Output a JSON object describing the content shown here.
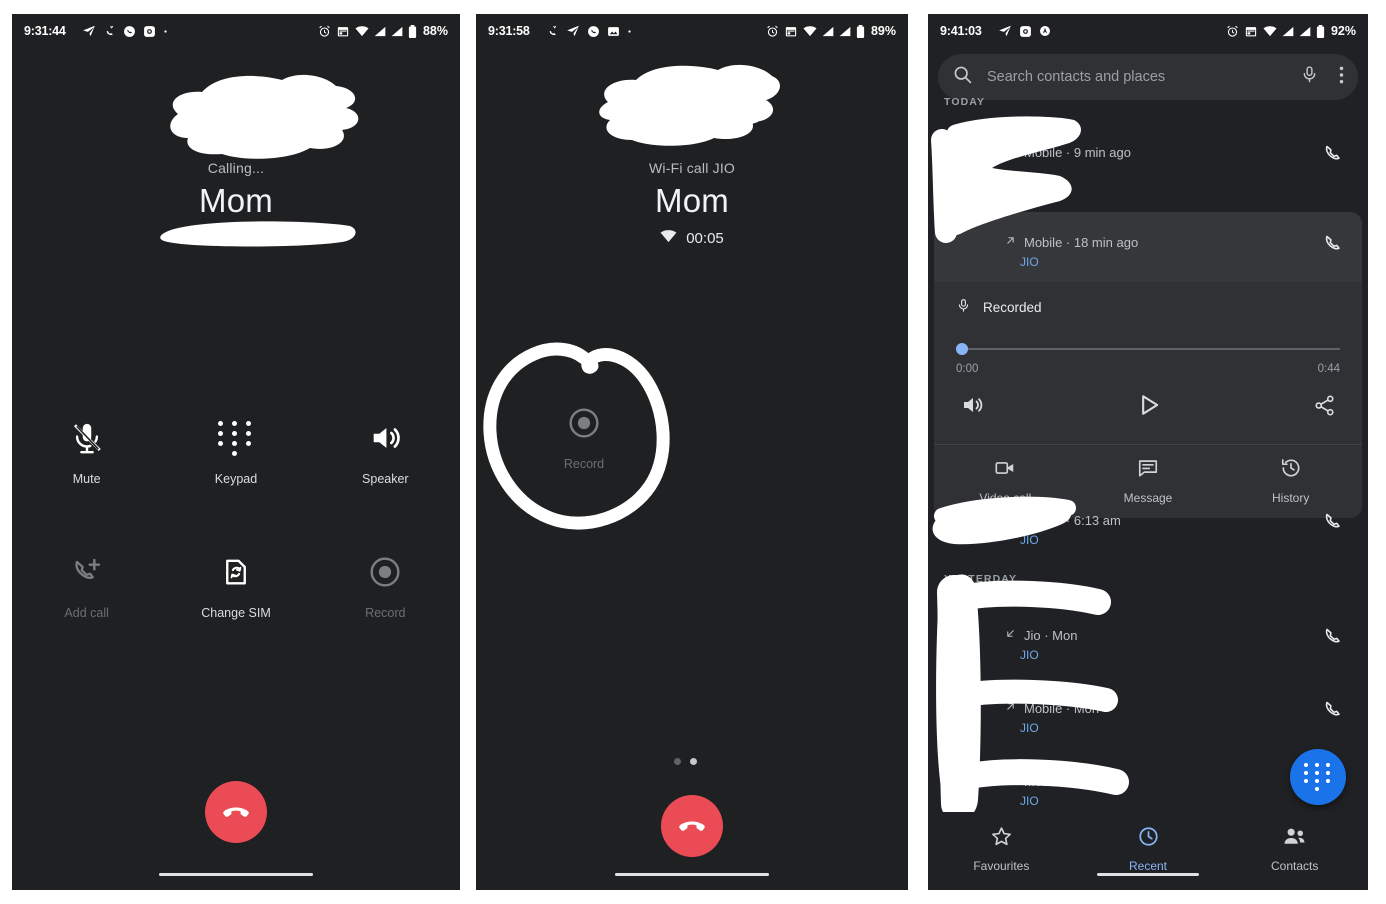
{
  "panels": [
    {
      "id": "incall-dialing",
      "statusbar": {
        "time": "9:31:44",
        "battery": "88%",
        "left_icons": [
          "navigation-icon",
          "call-missed-icon",
          "phone-icon",
          "photos-icon",
          "dot-icon"
        ],
        "right_icons": [
          "alarm-icon",
          "calendar-icon",
          "wifi-icon",
          "signal-icon",
          "signal-icon",
          "battery-icon"
        ]
      },
      "call": {
        "status": "Calling...",
        "name": "Mom"
      },
      "controls": [
        {
          "name": "mute",
          "label": "Mute",
          "icon": "mic-off-icon",
          "dim": false
        },
        {
          "name": "keypad",
          "label": "Keypad",
          "icon": "dialpad-icon",
          "dim": false
        },
        {
          "name": "speaker",
          "label": "Speaker",
          "icon": "volume-up-icon",
          "dim": false
        },
        {
          "name": "add-call",
          "label": "Add call",
          "icon": "add-call-icon",
          "dim": true
        },
        {
          "name": "change-sim",
          "label": "Change SIM",
          "icon": "sim-swap-icon",
          "dim": false
        },
        {
          "name": "record",
          "label": "Record",
          "icon": "record-icon",
          "dim": true
        }
      ],
      "end_call_icon": "call-end-icon"
    },
    {
      "id": "incall-connected",
      "statusbar": {
        "time": "9:31:58",
        "battery": "89%"
      },
      "call": {
        "status": "Wi-Fi call JIO",
        "name": "Mom",
        "duration": "00:05"
      },
      "controls": [
        {
          "name": "record",
          "label": "Record",
          "icon": "record-icon",
          "dim": true
        }
      ],
      "page_dots": {
        "count": 2,
        "active_index": 1
      },
      "end_call_icon": "call-end-icon"
    },
    {
      "id": "recents",
      "statusbar": {
        "time": "9:41:03",
        "battery": "92%"
      },
      "search": {
        "placeholder": "Search contacts and places",
        "search_icon": "search-icon",
        "voice_icon": "mic-icon",
        "overflow_icon": "more-vert-icon"
      },
      "sections": [
        {
          "header": "TODAY",
          "rows": [
            {
              "direction_icon": "call-outgoing-icon",
              "meta": "Mobile · 9 min ago",
              "sim": "",
              "action_icon": "phone-icon",
              "selected": false
            },
            {
              "direction_icon": "call-outgoing-icon",
              "meta": "Mobile · 18 min ago",
              "sim": "JIO",
              "action_icon": "phone-icon",
              "selected": true
            },
            {
              "direction_icon": "call-outgoing-icon",
              "meta": "Mobile · 6:13 am",
              "sim": "JIO",
              "action_icon": "phone-icon",
              "selected": false
            }
          ]
        },
        {
          "header": "YESTERDAY",
          "rows": [
            {
              "direction_icon": "call-incoming-icon",
              "meta": "Jio · Mon",
              "sim": "JIO",
              "action_icon": "phone-icon",
              "selected": false
            },
            {
              "direction_icon": "call-outgoing-icon",
              "meta": "Mobile · Mon",
              "sim": "JIO",
              "action_icon": "phone-icon",
              "selected": false
            },
            {
              "direction_icon": "call-outgoing-icon",
              "meta": "Mobile · Mon",
              "sim": "JIO",
              "action_icon": "phone-icon",
              "selected": false
            }
          ]
        }
      ],
      "recording": {
        "title": "Recorded",
        "mic_icon": "mic-icon",
        "elapsed": "0:00",
        "total": "0:44",
        "progress_percent": 0,
        "volume_icon": "volume-up-icon",
        "play_icon": "play-icon",
        "share_icon": "share-icon"
      },
      "quick_actions": [
        {
          "name": "video-call",
          "label": "Video call",
          "icon": "videocam-icon"
        },
        {
          "name": "message",
          "label": "Message",
          "icon": "message-icon"
        },
        {
          "name": "history",
          "label": "History",
          "icon": "history-icon"
        }
      ],
      "fab": {
        "name": "dialpad-fab",
        "icon": "dialpad-icon"
      },
      "bottom_nav": [
        {
          "name": "favourites",
          "label": "Favourites",
          "icon": "star-icon",
          "selected": false
        },
        {
          "name": "recent",
          "label": "Recent",
          "icon": "clock-icon",
          "selected": true
        },
        {
          "name": "contacts",
          "label": "Contacts",
          "icon": "people-icon",
          "selected": false
        }
      ]
    }
  ],
  "colors": {
    "background": "#1f2022",
    "surface": "#303134",
    "accent_blue": "#1a73e8",
    "link_blue": "#6ea8e8",
    "slider_blue": "#8ab4f8",
    "end_call_red": "#ea4b54",
    "text_primary": "#e8eaed",
    "text_secondary": "#9aa0a6",
    "redaction": "#ffffff"
  }
}
